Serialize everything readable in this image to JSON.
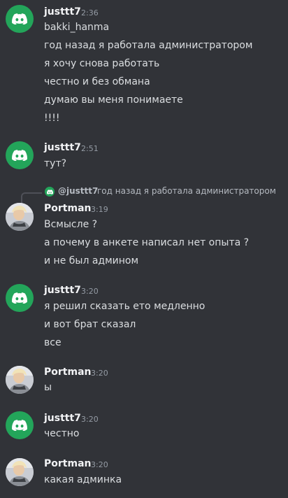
{
  "messages": [
    {
      "author": "justtt7",
      "time": "2:36",
      "lines": [
        "bakki_hanma",
        "год назад я работала администратором",
        "я хочу снова работать",
        "честно и без обмана",
        "думаю вы меня понимаете",
        "!!!!"
      ]
    },
    {
      "author": "justtt7",
      "time": "2:51",
      "lines": [
        "тут?"
      ]
    },
    {
      "author": "Portman",
      "time": "3:19",
      "reply": {
        "user": "@justtt7",
        "text": "год назад я работала администратором"
      },
      "lines": [
        "Всмысле ?",
        "а почему в анкете написал нет опыта ?",
        "и не был админом"
      ]
    },
    {
      "author": "justtt7",
      "time": "3:20",
      "lines": [
        "я решил сказать ето медленно",
        "и вот брат сказал",
        "все"
      ]
    },
    {
      "author": "Portman",
      "time": "3:20",
      "lines": [
        "ы"
      ]
    },
    {
      "author": "justtt7",
      "time": "3:20",
      "lines": [
        "честно"
      ]
    },
    {
      "author": "Portman",
      "time": "3:20",
      "lines": [
        "какая админка"
      ]
    }
  ],
  "icons": {
    "bot_avatar": "discord-logo-icon",
    "user_avatar": "profile-photo"
  },
  "colors": {
    "background": "#313338",
    "discord_green": "#23a55a",
    "username": "#f2f3f5",
    "timestamp": "#949ba4",
    "text": "#dbdee1"
  }
}
